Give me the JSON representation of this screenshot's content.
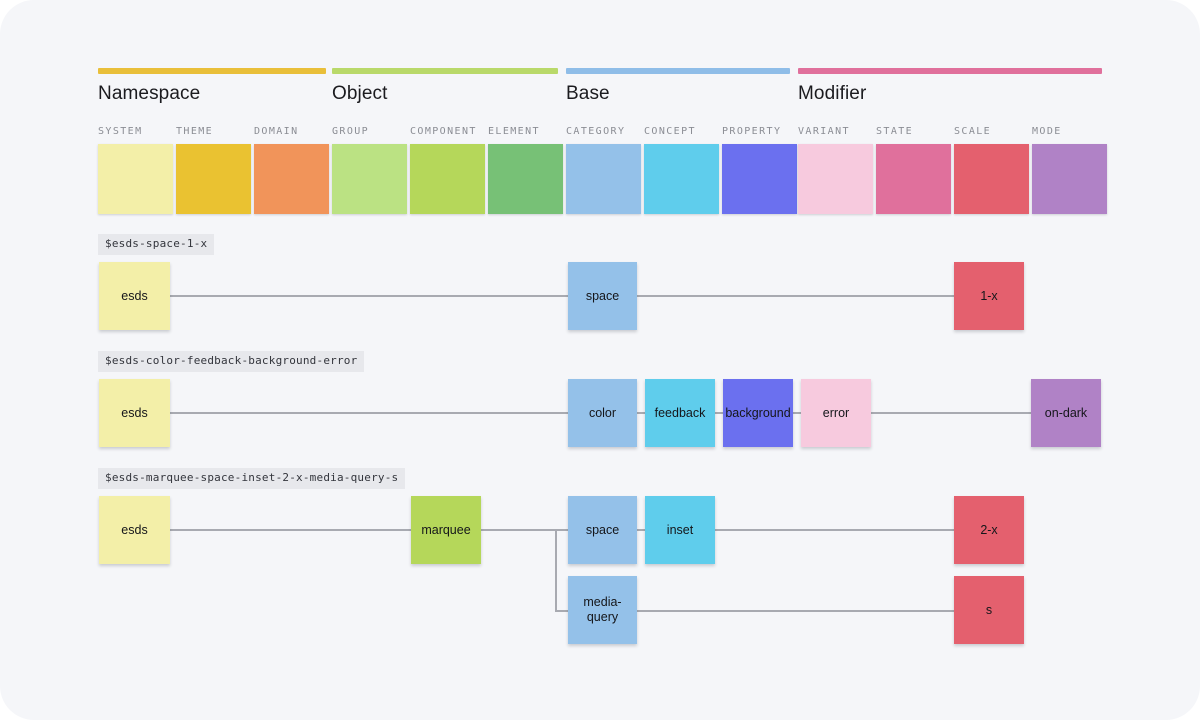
{
  "canvas": {
    "background": "#f5f6f9",
    "connector_color": "#a8aab1"
  },
  "groups": [
    {
      "id": "namespace",
      "title": "Namespace",
      "bar_color": "#e9bf3a"
    },
    {
      "id": "object",
      "title": "Object",
      "bar_color": "#b9d96a"
    },
    {
      "id": "base",
      "title": "Base",
      "bar_color": "#8fbde8"
    },
    {
      "id": "modifier",
      "title": "Modifier",
      "bar_color": "#e0709c"
    }
  ],
  "legend": [
    {
      "label": "SYSTEM",
      "color": "#f3efa8"
    },
    {
      "label": "THEME",
      "color": "#eac231"
    },
    {
      "label": "DOMAIN",
      "color": "#f1945a"
    },
    {
      "label": "GROUP",
      "color": "#bbe283"
    },
    {
      "label": "COMPONENT",
      "color": "#b5d75a"
    },
    {
      "label": "ELEMENT",
      "color": "#77c176"
    },
    {
      "label": "CATEGORY",
      "color": "#94c1e9"
    },
    {
      "label": "CONCEPT",
      "color": "#5fcdec"
    },
    {
      "label": "PROPERTY",
      "color": "#6b70ef"
    },
    {
      "label": "VARIANT",
      "color": "#f7cade"
    },
    {
      "label": "STATE",
      "color": "#e0709c"
    },
    {
      "label": "SCALE",
      "color": "#e4606e"
    },
    {
      "label": "MODE",
      "color": "#b082c6"
    }
  ],
  "rows": [
    {
      "token": "$esds-space-1-x",
      "nodes": [
        {
          "label": "esds",
          "color": "#f3efa8"
        },
        {
          "label": "space",
          "color": "#94c1e9"
        },
        {
          "label": "1-x",
          "color": "#e4606e"
        }
      ]
    },
    {
      "token": "$esds-color-feedback-background-error",
      "nodes": [
        {
          "label": "esds",
          "color": "#f3efa8"
        },
        {
          "label": "color",
          "color": "#94c1e9"
        },
        {
          "label": "feedback",
          "color": "#5fcdec"
        },
        {
          "label": "background",
          "color": "#6b70ef"
        },
        {
          "label": "error",
          "color": "#f7cade"
        },
        {
          "label": "on-dark",
          "color": "#b082c6"
        }
      ]
    },
    {
      "token": "$esds-marquee-space-inset-2-x-media-query-s",
      "nodes": [
        {
          "label": "esds",
          "color": "#f3efa8"
        },
        {
          "label": "marquee",
          "color": "#b5d75a"
        },
        {
          "label": "space",
          "color": "#94c1e9"
        },
        {
          "label": "inset",
          "color": "#5fcdec"
        },
        {
          "label": "2-x",
          "color": "#e4606e"
        },
        {
          "label": "media-query",
          "color": "#94c1e9"
        },
        {
          "label": "s",
          "color": "#e4606e"
        }
      ]
    }
  ]
}
